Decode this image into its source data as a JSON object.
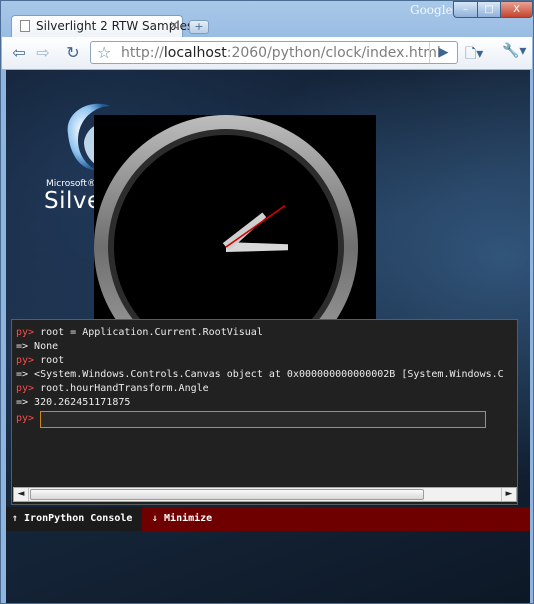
{
  "browser": {
    "brand": "Google",
    "tab_title": "Silverlight 2 RTW Samples...",
    "tab_close": "×",
    "new_tab": "+",
    "url_prefix": "http://",
    "url_host": "localhost",
    "url_rest": ":2060/python/clock/index.html",
    "window_min": "–",
    "window_max": "□",
    "window_close": "X"
  },
  "page": {
    "logo_small": "Microsoft®",
    "logo_big": "Silve"
  },
  "clock": {
    "hour_angle": 320.262451171875,
    "minute_angle": 250,
    "second_angle": 55
  },
  "console": {
    "lines": [
      {
        "prompt": "py>",
        "text": " root = Application.Current.RootVisual"
      },
      {
        "prompt": "",
        "text": "=> None"
      },
      {
        "prompt": "py>",
        "text": " root"
      },
      {
        "prompt": "",
        "text": "=> <System.Windows.Controls.Canvas object at 0x000000000000002B [System.Windows.C"
      },
      {
        "prompt": "py>",
        "text": " root.hourHandTransform.Angle"
      },
      {
        "prompt": "",
        "text": "=> 320.262451171875"
      },
      {
        "prompt": "py>",
        "text": ""
      }
    ],
    "input_value": "",
    "scroll_left": "◄",
    "scroll_right": "►"
  },
  "bottom_bar": {
    "console_tab": "⇑ IronPython Console",
    "minimize": "⇓ Minimize"
  },
  "colors": {
    "prompt": "#ff4a4a",
    "bar": "#6e0000",
    "second_hand": "#d10000"
  }
}
